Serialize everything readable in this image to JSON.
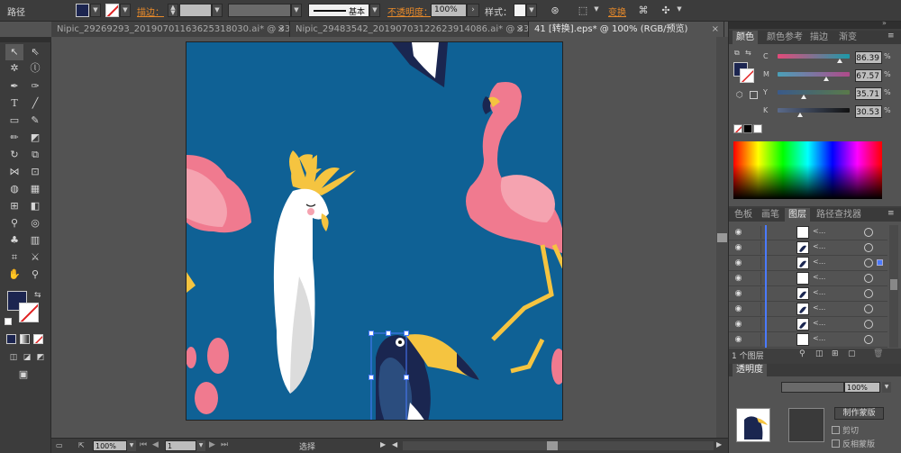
{
  "control_bar": {
    "selection_label": "路径",
    "stroke_label": "描边：",
    "stroke_style_label": "基本",
    "opacity_label": "不透明度：",
    "opacity_value": "100%",
    "style_label": "样式：",
    "transform_label": "变换",
    "fill_color": "#1c2550",
    "accent_color": "#e88a2a"
  },
  "tabs": [
    {
      "label": "Nipic_29269293_20190701163625318030.ai* @ 33....",
      "close": "×"
    },
    {
      "label": "Nipic_29483542_20190703122623914086.ai* @ 33....",
      "close": "×"
    },
    {
      "label": "41 [转换].eps* @ 100% (RGB/预览)",
      "close": "×"
    }
  ],
  "toolbar": {
    "tools": [
      "selection-tool",
      "direct-selection-tool",
      "magic-wand-tool",
      "lasso-tool",
      "pen-tool",
      "curvature-tool",
      "type-tool",
      "line-tool",
      "rectangle-tool",
      "paintbrush-tool",
      "pencil-tool",
      "eraser-tool",
      "rotate-tool",
      "scale-tool",
      "width-tool",
      "free-transform-tool",
      "shape-builder-tool",
      "perspective-grid-tool",
      "mesh-tool",
      "gradient-tool",
      "eyedropper-tool",
      "blend-tool",
      "symbol-sprayer-tool",
      "column-graph-tool",
      "artboard-tool",
      "slice-tool",
      "hand-tool",
      "zoom-tool"
    ],
    "fill_color": "#1c2550"
  },
  "status_bar": {
    "zoom": "100%",
    "artboard_number": "1",
    "status_text": "选择"
  },
  "color_panel": {
    "tabs": [
      "颜色",
      "颜色参考",
      "描边",
      "渐变"
    ],
    "channels": [
      {
        "label": "C",
        "value": "86.39",
        "pct": 0.86,
        "gradient": "linear-gradient(to right,#e44a7a,#1c9aa8)"
      },
      {
        "label": "M",
        "value": "67.57",
        "pct": 0.68,
        "gradient": "linear-gradient(to right,#4aa0b8,#b04a8a)"
      },
      {
        "label": "Y",
        "value": "35.71",
        "pct": 0.36,
        "gradient": "linear-gradient(to right,#3a5a8a,#5a7a4a)"
      },
      {
        "label": "K",
        "value": "30.53",
        "pct": 0.31,
        "gradient": "linear-gradient(to right,#5a6a8a,#111)"
      }
    ]
  },
  "layers_panel": {
    "tabs": [
      "色板",
      "画笔",
      "图层",
      "路径查找器"
    ],
    "rows": [
      {
        "name": "<...",
        "thumb": "white"
      },
      {
        "name": "<...",
        "thumb": "stroke"
      },
      {
        "name": "<...",
        "thumb": "beak"
      },
      {
        "name": "<...",
        "thumb": "white"
      },
      {
        "name": "<...",
        "thumb": "wing"
      },
      {
        "name": "<...",
        "thumb": "feather"
      },
      {
        "name": "<...",
        "thumb": "tail"
      },
      {
        "name": "<...",
        "thumb": "white"
      }
    ],
    "footer_count": "1 个图层"
  },
  "transparency_panel": {
    "tab": "透明度",
    "opacity_value": "100%",
    "make_mask_button": "制作蒙版",
    "clip_label": "剪切",
    "invert_mask_label": "反相蒙版"
  }
}
